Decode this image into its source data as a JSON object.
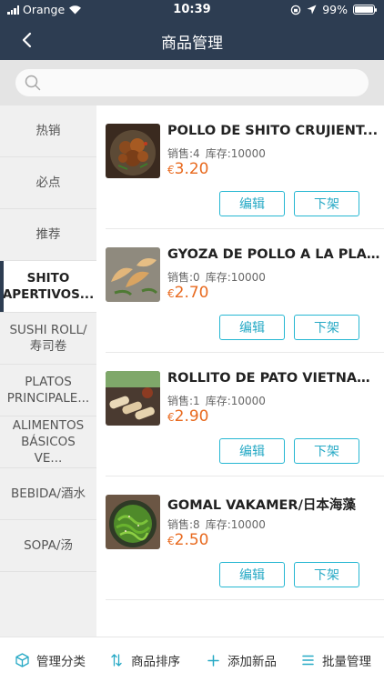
{
  "status_bar": {
    "carrier": "Orange",
    "time": "10:39",
    "battery": "99%",
    "battery_level": 0.99,
    "icons": [
      "signal-bars-icon",
      "wifi-icon",
      "rotation-lock-icon",
      "location-arrow-icon",
      "battery-icon"
    ]
  },
  "nav": {
    "title": "商品管理",
    "back_icon": "chevron-left-icon"
  },
  "search": {
    "placeholder": "",
    "value": "",
    "icon": "search-icon"
  },
  "categories": [
    {
      "label": "热销",
      "active": false
    },
    {
      "label": "必点",
      "active": false
    },
    {
      "label": "推荐",
      "active": false
    },
    {
      "label": "SHITO APERTIVOS...",
      "active": true
    },
    {
      "label": "SUSHI ROLL/寿司卷",
      "active": false
    },
    {
      "label": "PLATOS PRINCIPALE...",
      "active": false
    },
    {
      "label": "ALIMENTOS BÁSICOS VE...",
      "active": false
    },
    {
      "label": "BEBIDA/酒水",
      "active": false
    },
    {
      "label": "SOPA/汤",
      "active": false
    }
  ],
  "products": [
    {
      "name": "POLLO DE SHITO CRUJIENT...",
      "sales_label": "销售:4",
      "stock_label": "库存:10000",
      "currency": "€",
      "price": "3.20",
      "image": "fried-chicken-image",
      "edit_label": "编辑",
      "offshelf_label": "下架"
    },
    {
      "name": "GYOZA DE POLLO A LA PLAN...",
      "sales_label": "销售:0",
      "stock_label": "库存:10000",
      "currency": "€",
      "price": "2.70",
      "image": "gyoza-image",
      "edit_label": "编辑",
      "offshelf_label": "下架"
    },
    {
      "name": "ROLLITO DE PATO VIETNAMI...",
      "sales_label": "销售:1",
      "stock_label": "库存:10000",
      "currency": "€",
      "price": "2.90",
      "image": "spring-rolls-image",
      "edit_label": "编辑",
      "offshelf_label": "下架"
    },
    {
      "name": "GOMAL VAKAMER/日本海藻",
      "sales_label": "销售:8",
      "stock_label": "库存:10000",
      "currency": "€",
      "price": "2.50",
      "image": "seaweed-salad-image",
      "edit_label": "编辑",
      "offshelf_label": "下架"
    }
  ],
  "toolbar": {
    "manage_categories": "管理分类",
    "sort_products": "商品排序",
    "add_product": "添加新品",
    "batch_manage": "批量管理",
    "icons": [
      "cube-icon",
      "sort-arrows-icon",
      "plus-icon",
      "list-icon"
    ]
  },
  "colors": {
    "header_bg": "#2d3d52",
    "accent": "#26a9c5",
    "price": "#e86a1f",
    "sidebar_bg": "#f0f0f0",
    "search_bg": "#e4e4e4"
  }
}
